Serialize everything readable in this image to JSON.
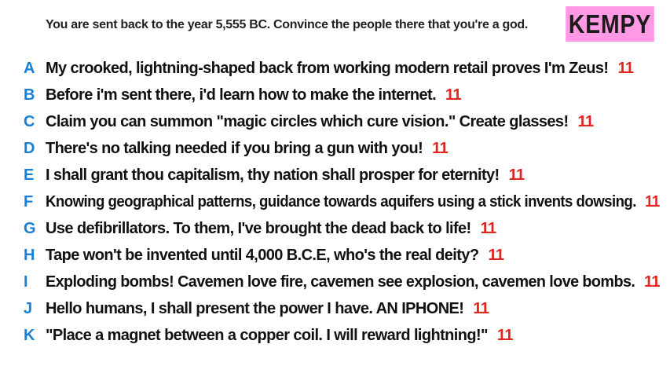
{
  "prompt": "You are sent back to the year 5,555 BC. Convince the people there that you're a god.",
  "badge": "KEMPY",
  "answers": [
    {
      "letter": "A",
      "text": "My crooked, lightning-shaped back from working modern retail proves I'm Zeus!",
      "score": "11"
    },
    {
      "letter": "B",
      "text": "Before i'm sent there, i'd learn how to make the internet.",
      "score": "11"
    },
    {
      "letter": "C",
      "text": "Claim you can summon \"magic circles which cure vision.\" Create glasses!",
      "score": "11"
    },
    {
      "letter": "D",
      "text": "There's no talking needed if you bring a gun with you!",
      "score": "11"
    },
    {
      "letter": "E",
      "text": "I shall grant thou capitalism, thy nation shall prosper for eternity!",
      "score": "11"
    },
    {
      "letter": "F",
      "text": "Knowing geographical patterns, guidance towards aquifers using a stick invents dowsing.",
      "score": "11"
    },
    {
      "letter": "G",
      "text": "Use defibrillators. To them, I've brought the dead back to life!",
      "score": "11"
    },
    {
      "letter": "H",
      "text": "Tape won't be invented until 4,000 B.C.E, who's the real deity?",
      "score": "11"
    },
    {
      "letter": "I",
      "text": "Exploding bombs! Cavemen love fire, cavemen see explosion, cavemen love bombs.",
      "score": "11"
    },
    {
      "letter": "J",
      "text": "Hello humans, I shall present the power I have. AN IPHONE!",
      "score": "11"
    },
    {
      "letter": "K",
      "text": "\"Place a magnet between a copper coil. I will reward lightning!\"",
      "score": "11"
    }
  ],
  "colors": {
    "letter": "#1a7fd6",
    "score": "#e0251f",
    "badge_bg": "#ff99e6"
  }
}
